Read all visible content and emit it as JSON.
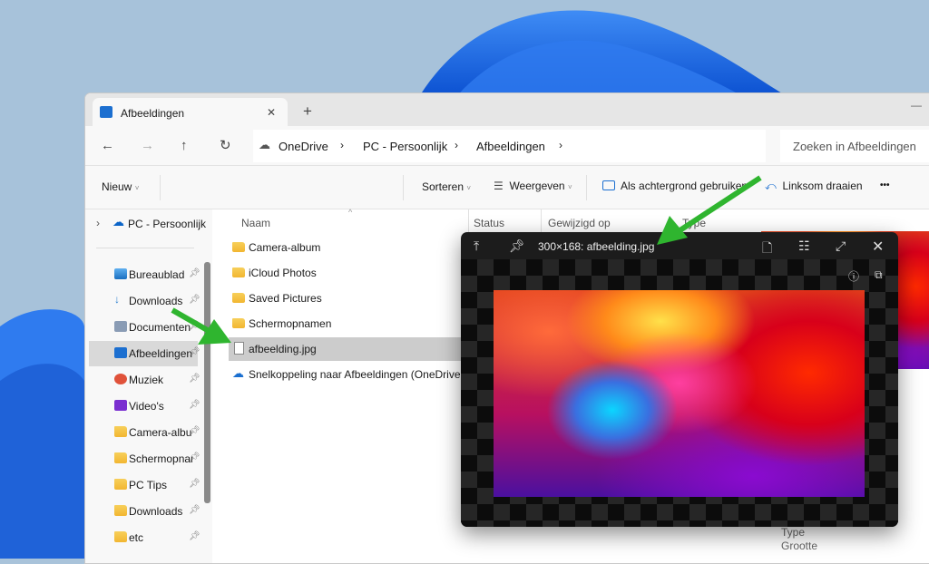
{
  "window": {
    "tab_title": "Afbeeldingen",
    "new_tab": "+",
    "close_tab": "✕"
  },
  "address": {
    "breadcrumbs": [
      "OneDrive",
      "PC - Persoonlijk",
      "Afbeeldingen"
    ],
    "search_placeholder": "Zoeken in Afbeeldingen"
  },
  "toolbar": {
    "new": "Nieuw",
    "sort": "Sorteren",
    "view": "Weergeven",
    "set_background": "Als achtergrond gebruiken",
    "rotate_left": "Linksom draaien",
    "more": "•••"
  },
  "sidebar": {
    "root": "PC - Persoonlijk",
    "items": [
      {
        "label": "Bureaublad",
        "icon": "desktop-icon"
      },
      {
        "label": "Downloads",
        "icon": "download-icon"
      },
      {
        "label": "Documenten",
        "icon": "document-icon"
      },
      {
        "label": "Afbeeldingen",
        "icon": "pictures-icon",
        "selected": true
      },
      {
        "label": "Muziek",
        "icon": "music-icon"
      },
      {
        "label": "Video's",
        "icon": "video-icon"
      },
      {
        "label": "Camera-album",
        "icon": "folder-icon"
      },
      {
        "label": "Schermopnamen",
        "icon": "folder-icon"
      },
      {
        "label": "PC Tips",
        "icon": "folder-icon"
      },
      {
        "label": "Downloads",
        "icon": "folder-icon"
      },
      {
        "label": "etc",
        "icon": "folder-icon"
      }
    ]
  },
  "columns": [
    "Naam",
    "Status",
    "Gewijzigd op",
    "Type"
  ],
  "files": [
    {
      "name": "Camera-album",
      "icon": "folder-icon"
    },
    {
      "name": "iCloud Photos",
      "icon": "folder-icon"
    },
    {
      "name": "Saved Pictures",
      "icon": "folder-icon"
    },
    {
      "name": "Schermopnamen",
      "icon": "folder-icon"
    },
    {
      "name": "afbeelding.jpg",
      "icon": "image-file-icon",
      "selected": true
    },
    {
      "name": "Snelkoppeling naar Afbeeldingen (OneDrive - ...",
      "icon": "onedrive-shortcut-icon"
    }
  ],
  "viewer": {
    "title": "300×168: afbeelding.jpg"
  },
  "details": {
    "type_label": "Type",
    "size_label": "Grootte"
  },
  "colors": {
    "accent": "#0067c0",
    "arrow": "#2fb52f",
    "selection": "#cccccc"
  }
}
